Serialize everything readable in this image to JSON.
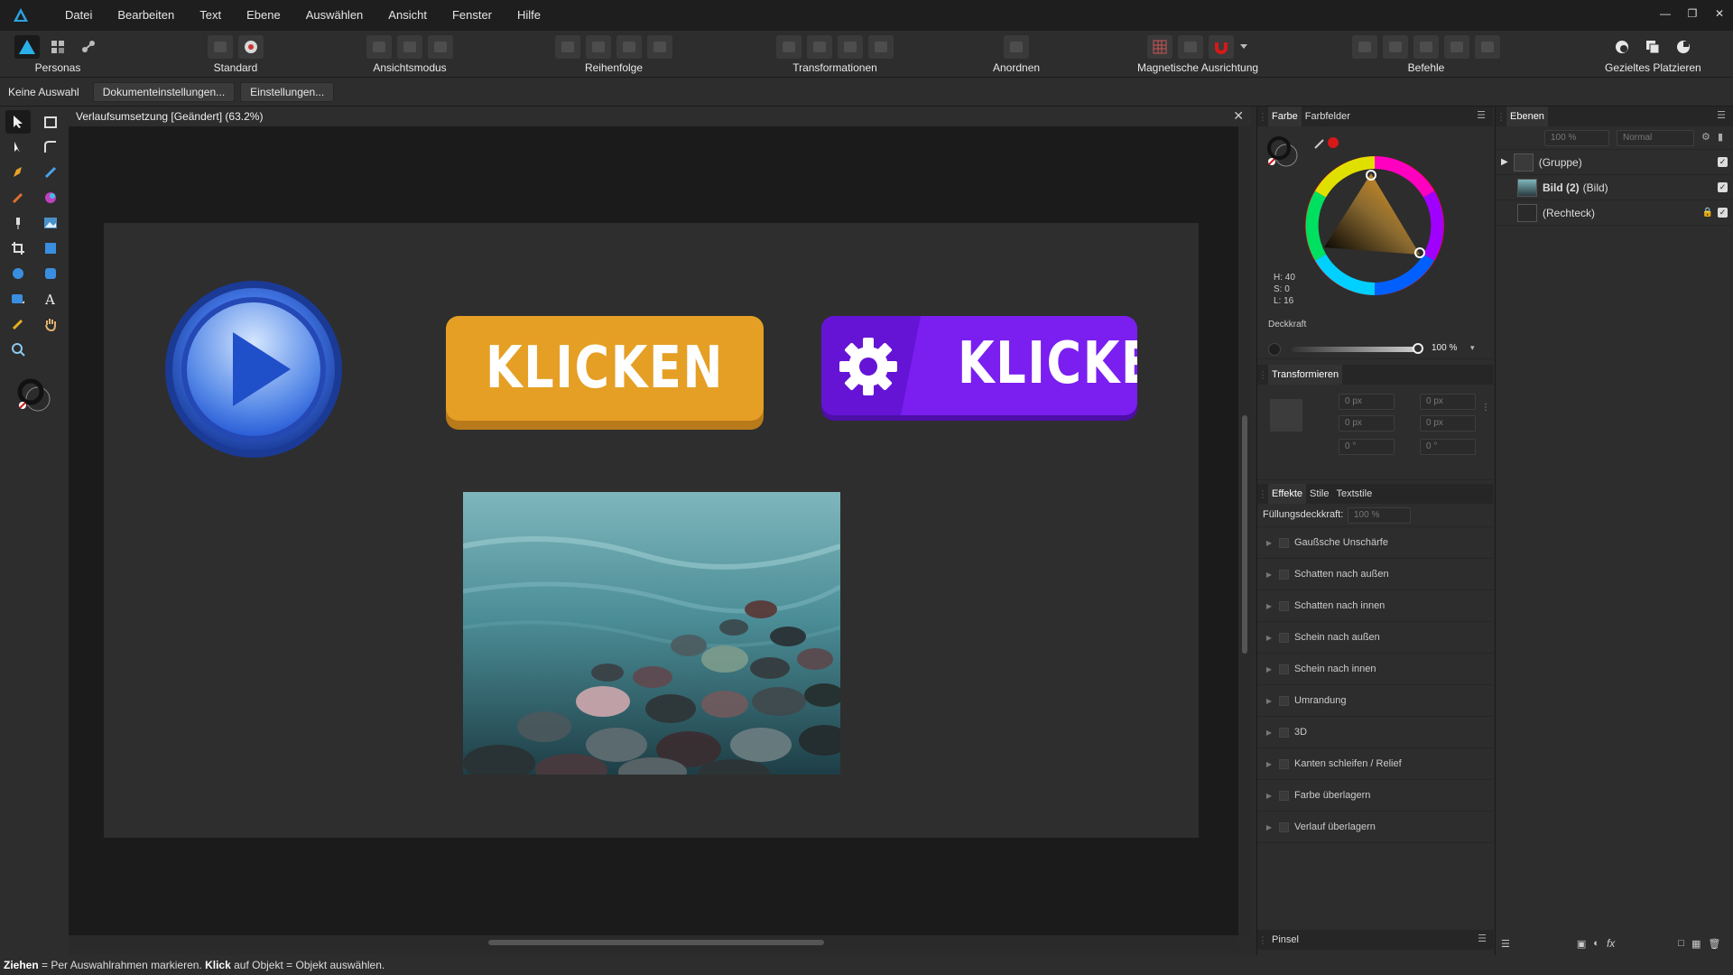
{
  "menu": [
    "Datei",
    "Bearbeiten",
    "Text",
    "Ebene",
    "Auswählen",
    "Ansicht",
    "Fenster",
    "Hilfe"
  ],
  "toolbar": {
    "personas": "Personas",
    "standard": "Standard",
    "ansichtsmodus": "Ansichtsmodus",
    "reihenfolge": "Reihenfolge",
    "transformationen": "Transformationen",
    "anordnen": "Anordnen",
    "magnetische": "Magnetische Ausrichtung",
    "befehle": "Befehle",
    "gezieltes": "Gezieltes Platzieren"
  },
  "context": {
    "selection": "Keine Auswahl",
    "doc_settings": "Dokumenteinstellungen...",
    "settings": "Einstellungen..."
  },
  "document": {
    "tab_title": "Verlaufsumsetzung [Geändert] (63.2%)",
    "button_text_1": "KLICKEN",
    "button_text_2": "KLICKEN"
  },
  "color_panel": {
    "tab_farbe": "Farbe",
    "tab_farbfelder": "Farbfelder",
    "h": "H: 40",
    "s": "S: 0",
    "l": "L: 16",
    "opacity_label": "Deckkraft",
    "opacity_value": "100 %",
    "accent_red": "#d61818"
  },
  "transform_panel": {
    "title": "Transformieren",
    "x": "0 px",
    "y": "0 px",
    "w": "0 px",
    "h": "0 px",
    "r": "0 °",
    "s": "0 °"
  },
  "effects_panel": {
    "tab_effekte": "Effekte",
    "tab_stile": "Stile",
    "tab_textstile": "Textstile",
    "fill_opacity_label": "Füllungsdeckkraft:",
    "fill_opacity_value": "100 %",
    "effects": [
      "Gaußsche Unschärfe",
      "Schatten nach außen",
      "Schatten nach innen",
      "Schein nach außen",
      "Schein nach innen",
      "Umrandung",
      "3D",
      "Kanten schleifen / Relief",
      "Farbe überlagern",
      "Verlauf überlagern"
    ]
  },
  "brush_panel": {
    "title": "Pinsel"
  },
  "layers_panel": {
    "title": "Ebenen",
    "opacity": "100 %",
    "blend_mode": "Normal",
    "layers": [
      {
        "name": "(Gruppe)",
        "bold_name": ""
      },
      {
        "name": "(Bild)",
        "bold_name": "Bild (2)"
      },
      {
        "name": "(Rechteck)",
        "bold_name": ""
      }
    ]
  },
  "status": {
    "key1": "Ziehen",
    "text1": " = Per Auswahlrahmen markieren. ",
    "key2": "Klick",
    "text2": " auf Objekt = Objekt auswählen."
  },
  "colors": {
    "orange": "#e59f24",
    "purple": "#7a1ff0",
    "play_blue": "#2c5fd8"
  }
}
